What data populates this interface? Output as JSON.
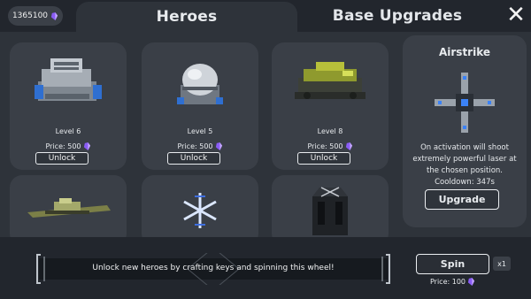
{
  "currency": {
    "amount": "1365100",
    "icon": "crystal-icon",
    "color": "#9b6bff"
  },
  "tabs": [
    {
      "label": "Heroes",
      "active": true
    },
    {
      "label": "Base Upgrades",
      "active": false
    }
  ],
  "close_icon": "close-icon",
  "heroes": [
    {
      "level": "Level 6",
      "price_label": "Price: 500",
      "button": "Unlock",
      "icon": "fortress-ship-icon"
    },
    {
      "level": "Level 5",
      "price_label": "Price: 500",
      "button": "Unlock",
      "icon": "dome-turret-icon"
    },
    {
      "level": "Level 8",
      "price_label": "Price: 500",
      "button": "Unlock",
      "icon": "tank-icon"
    },
    {
      "icon": "fighter-ship-icon"
    },
    {
      "icon": "snowflake-icon"
    },
    {
      "icon": "cannon-pod-icon"
    }
  ],
  "side": {
    "title": "Airstrike",
    "description": "On activation will shoot extremely powerful laser at the chosen position.",
    "cooldown": "Cooldown: 347s",
    "button": "Upgrade",
    "icon": "airstrike-drone-icon"
  },
  "bottom": {
    "wheel_text": "Unlock new heroes by crafting keys and spinning this wheel!",
    "spin_label": "Spin",
    "multiplier": "x1",
    "spin_price": "Price: 100"
  }
}
